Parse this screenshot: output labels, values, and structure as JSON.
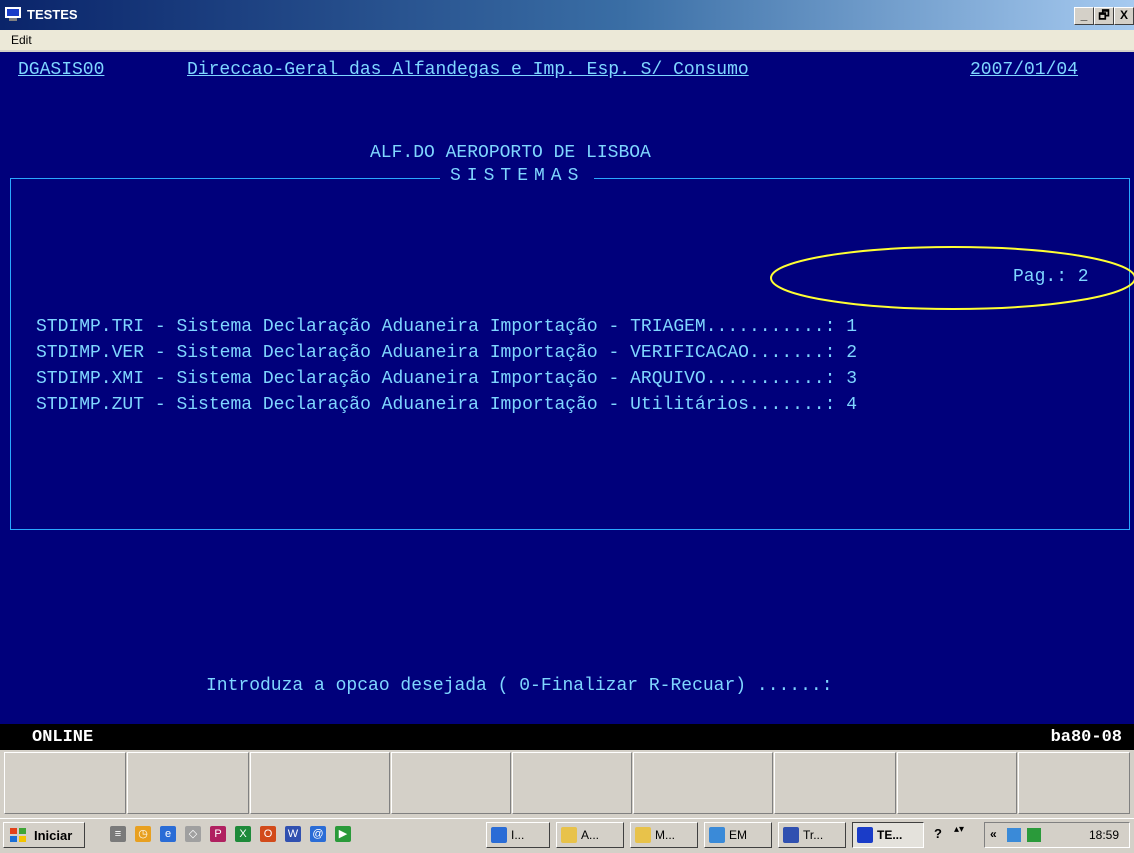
{
  "window": {
    "title": "TESTES",
    "menu": [
      "Edit"
    ],
    "buttons": [
      "_",
      "🗗",
      "X"
    ]
  },
  "terminal": {
    "header_left": "DGASIS00",
    "header_center": "Direccao-Geral das Alfandegas e Imp. Esp. S/ Consumo",
    "header_date": "2007/01/04",
    "subtitle": "ALF.DO AEROPORTO DE LISBOA",
    "panel_title": "SISTEMAS",
    "page_label": "Pag.: 2",
    "options": [
      {
        "code": "STDIMP.TRI",
        "description": "Sistema Declaração Aduaneira Importação",
        "module": "TRIAGEM",
        "dots": "...........",
        "number": "1"
      },
      {
        "code": "STDIMP.VER",
        "description": "Sistema Declaração Aduaneira Importação",
        "module": "VERIFICACAO",
        "dots": ".......",
        "number": "2"
      },
      {
        "code": "STDIMP.XMI",
        "description": "Sistema Declaração Aduaneira Importação",
        "module": "ARQUIVO",
        "dots": "...........",
        "number": "3"
      },
      {
        "code": "STDIMP.ZUT",
        "description": "Sistema Declaração Aduaneira Importação",
        "module": "Utilitários",
        "dots": ".......",
        "number": "4"
      }
    ],
    "prompt": "Introduza a opcao desejada ( 0-Finalizar R-Recuar) ......:",
    "status_left": "ONLINE",
    "status_right": "ba80-08"
  },
  "taskbar": {
    "start_label": "Iniciar",
    "tasks": [
      {
        "label": "I...",
        "icon": "ie-icon",
        "color": "#2a6cd6"
      },
      {
        "label": "A...",
        "icon": "folder-icon",
        "color": "#e8c24a"
      },
      {
        "label": "M...",
        "icon": "folder-icon",
        "color": "#e8c24a"
      },
      {
        "label": "EM",
        "icon": "network-icon",
        "color": "#3a8ad8"
      },
      {
        "label": "Tr...",
        "icon": "word-icon",
        "color": "#3050b0"
      },
      {
        "label": "TE...",
        "icon": "terminal-icon",
        "color": "#1a3cc8"
      }
    ],
    "tray_glyphs": [
      "?",
      "▴▾",
      "«"
    ],
    "clock": "18:59"
  },
  "colors": {
    "terminal_bg": "#00007b",
    "terminal_text": "#7fd6ff",
    "annotation": "#ffff33"
  }
}
